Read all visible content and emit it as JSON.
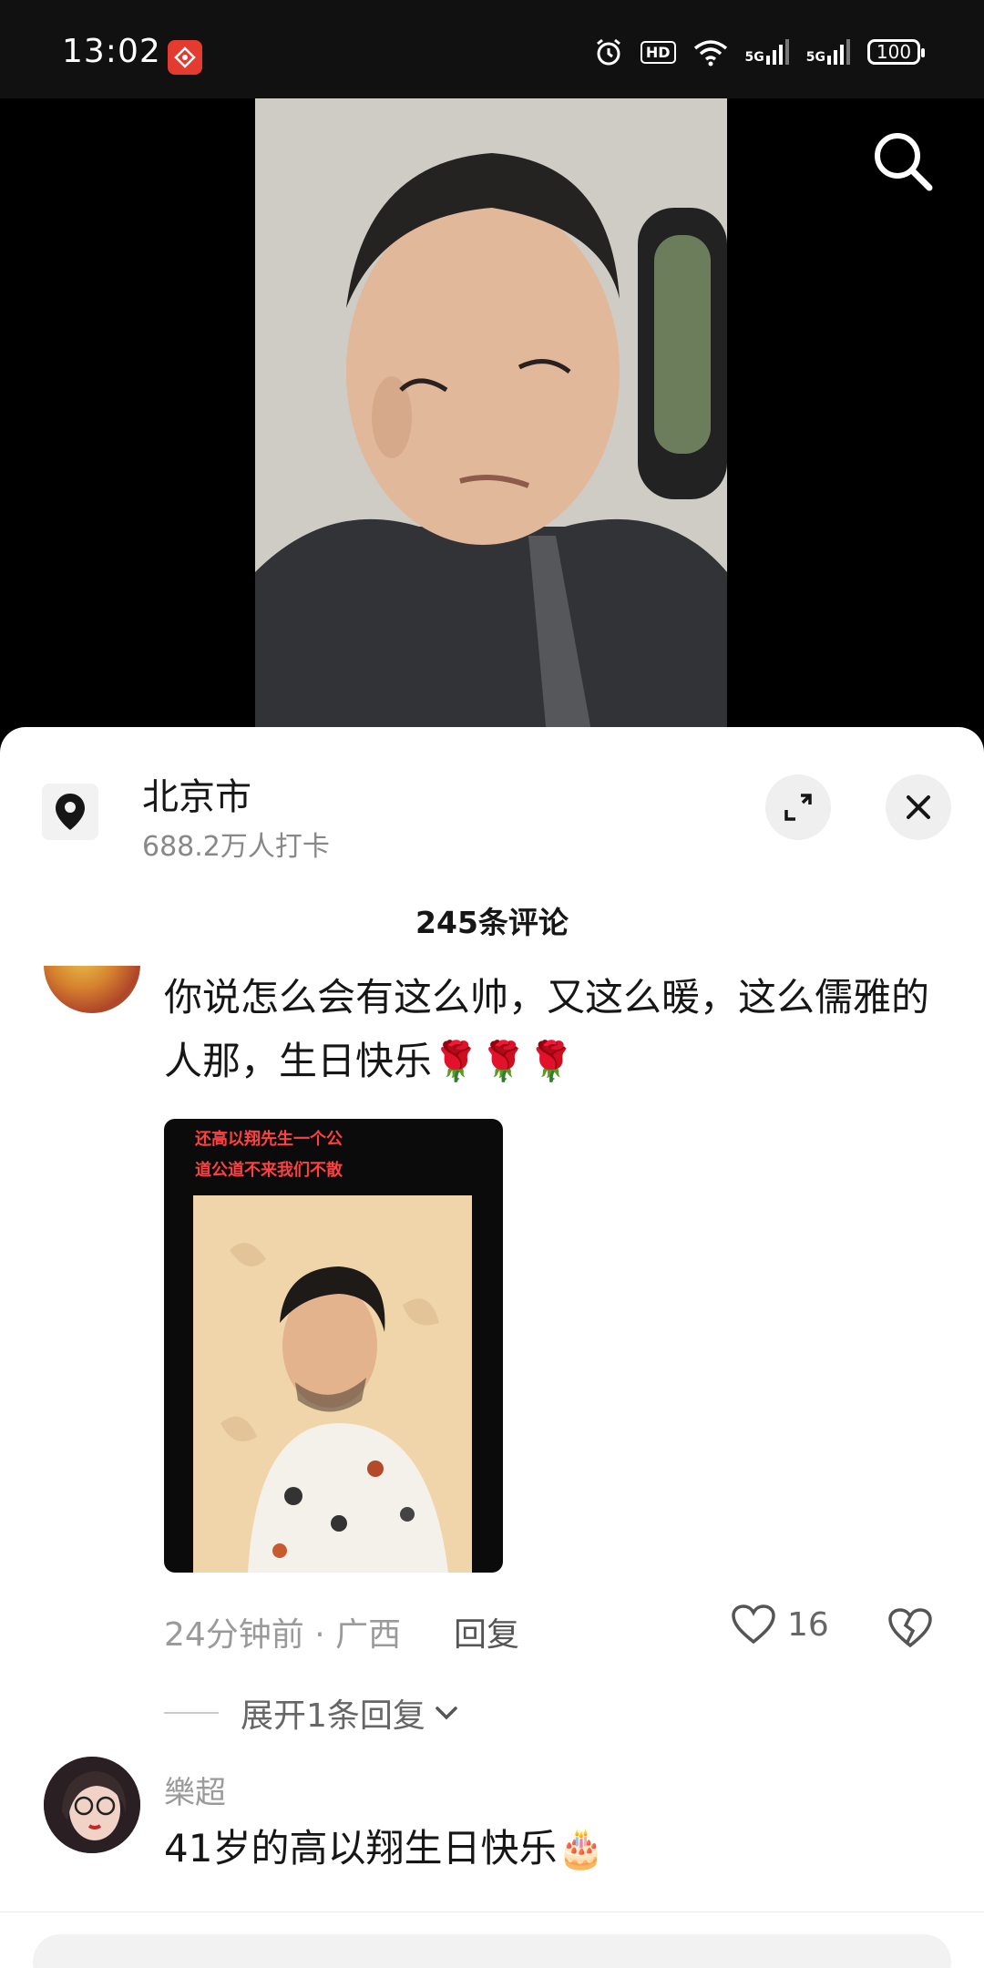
{
  "status_bar": {
    "time": "13:02",
    "hd_label": "HD",
    "signal_1": "5G",
    "signal_2": "5G",
    "battery": "100"
  },
  "location": {
    "title": "北京市",
    "subtitle": "688.2万人打卡"
  },
  "comments_header": {
    "count_label": "245条评论"
  },
  "comments": [
    {
      "author": "",
      "text": "你说怎么会有这么帅，又这么暖，这么儒雅的人那，生日快乐🌹🌹🌹",
      "image_caption_line1": "还高以翔先生一个公",
      "image_caption_line2": "道公道不来我们不散",
      "meta": "24分钟前 · 广西",
      "reply_label": "回复",
      "like_count": "16",
      "expand_label": "展开1条回复"
    },
    {
      "author": "樂超",
      "text": "41岁的高以翔生日快乐🎂"
    }
  ],
  "colors": {
    "accent_red": "#e33b2f",
    "text_primary": "#161616",
    "text_secondary": "#9a9a9a"
  },
  "icons": [
    "search-icon",
    "location-pin-icon",
    "expand-icon",
    "close-icon",
    "heart-icon",
    "broken-heart-icon",
    "chevron-down-icon"
  ]
}
